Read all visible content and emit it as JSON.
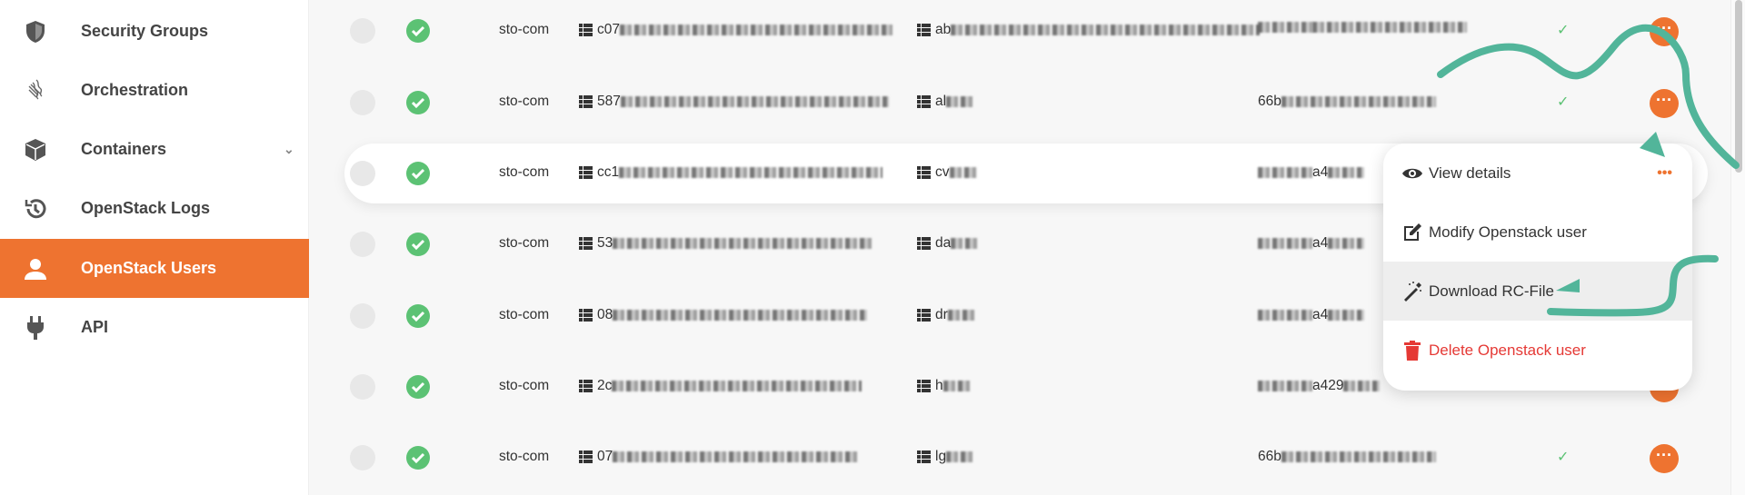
{
  "sidebar": {
    "items": [
      {
        "label": "Security Groups",
        "icon": "shield-icon"
      },
      {
        "label": "Orchestration",
        "icon": "orchestration-icon"
      },
      {
        "label": "Containers",
        "icon": "cube-icon",
        "has_submenu": true
      },
      {
        "label": "OpenStack Logs",
        "icon": "history-icon"
      },
      {
        "label": "OpenStack Users",
        "icon": "user-icon",
        "active": true
      },
      {
        "label": "API",
        "icon": "plug-icon"
      }
    ]
  },
  "rows": [
    {
      "project": "sto-com",
      "id": "c07",
      "name": "ab",
      "third": "",
      "verified": true
    },
    {
      "project": "sto-com",
      "id": "587",
      "name": "al",
      "third": "66b",
      "verified": true
    },
    {
      "project": "sto-com",
      "id": "cc1",
      "name": "cv",
      "third": "a4",
      "verified": false
    },
    {
      "project": "sto-com",
      "id": "53",
      "name": "da",
      "third": "a4",
      "verified": false
    },
    {
      "project": "sto-com",
      "id": "08",
      "name": "dr",
      "third": "a4",
      "verified": false
    },
    {
      "project": "sto-com",
      "id": "2c",
      "name": "h",
      "third": "a429",
      "verified": false
    },
    {
      "project": "sto-com",
      "id": "07",
      "name": "lg",
      "third": "66b",
      "verified": true
    }
  ],
  "menu": {
    "items": [
      {
        "label": "View details",
        "icon": "eye-icon"
      },
      {
        "label": "Modify Openstack user",
        "icon": "edit-icon"
      },
      {
        "label": "Download RC-File",
        "icon": "magic-wand-icon",
        "hovered": true
      },
      {
        "label": "Delete Openstack user",
        "icon": "trash-icon",
        "danger": true
      }
    ]
  },
  "colors": {
    "accent": "#ee7330",
    "success": "#5cc274",
    "danger": "#e53935",
    "annotation": "#52b59a"
  }
}
